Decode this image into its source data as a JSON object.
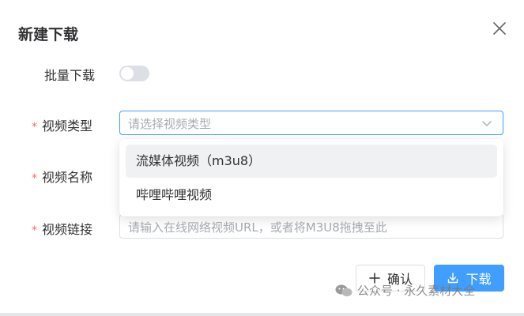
{
  "dialog": {
    "title": "新建下载",
    "close_icon": "close-icon"
  },
  "form": {
    "batch": {
      "label": "批量下载",
      "enabled": false
    },
    "video_type": {
      "label": "视频类型",
      "required_mark": "*",
      "placeholder": "请选择视频类型",
      "options": [
        "流媒体视频（m3u8）",
        "哔哩哔哩视频"
      ]
    },
    "video_name": {
      "label": "视频名称",
      "required_mark": "*"
    },
    "video_link": {
      "label": "视频链接",
      "required_mark": "*",
      "placeholder": "请输入在线网络视频URL，或者将M3U8拖拽至此"
    }
  },
  "footer": {
    "confirm_label": "确认",
    "download_label": "下载"
  },
  "watermark": {
    "text": "公众号 · 永久素材大全"
  },
  "colors": {
    "primary": "#409eff",
    "required": "#f56c6c",
    "border": "#dcdfe6",
    "placeholder": "#a8abb2"
  }
}
